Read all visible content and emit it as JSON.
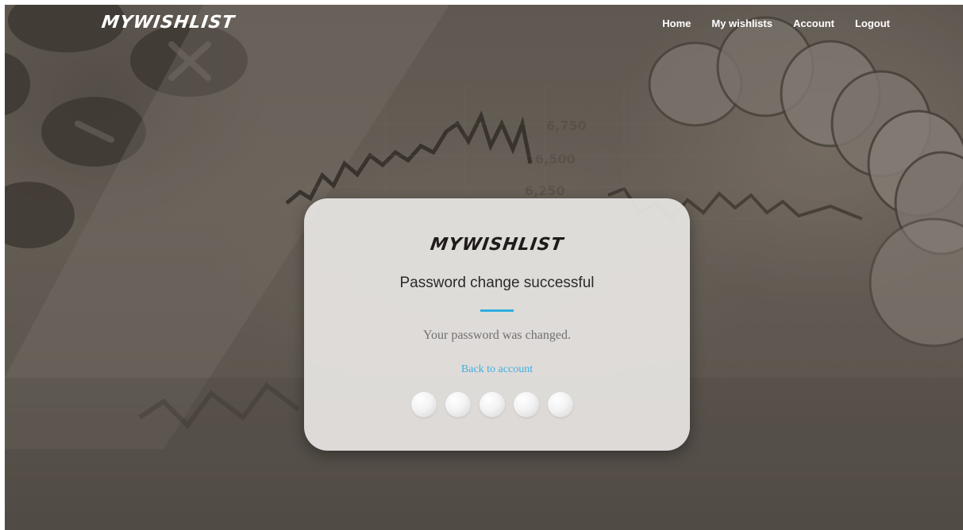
{
  "header": {
    "logo": "MYWISHLIST",
    "nav": [
      {
        "label": "Home"
      },
      {
        "label": "My wishlists"
      },
      {
        "label": "Account"
      },
      {
        "label": "Logout"
      }
    ]
  },
  "card": {
    "logo": "MYWISHLIST",
    "title": "Password change successful",
    "message": "Your password was changed.",
    "link": "Back to account",
    "dot_count": 5
  },
  "colors": {
    "accent": "#2eaee0",
    "link": "#3fb0e0",
    "card_background": "#e7e5e3",
    "nav_text": "#ffffff"
  }
}
